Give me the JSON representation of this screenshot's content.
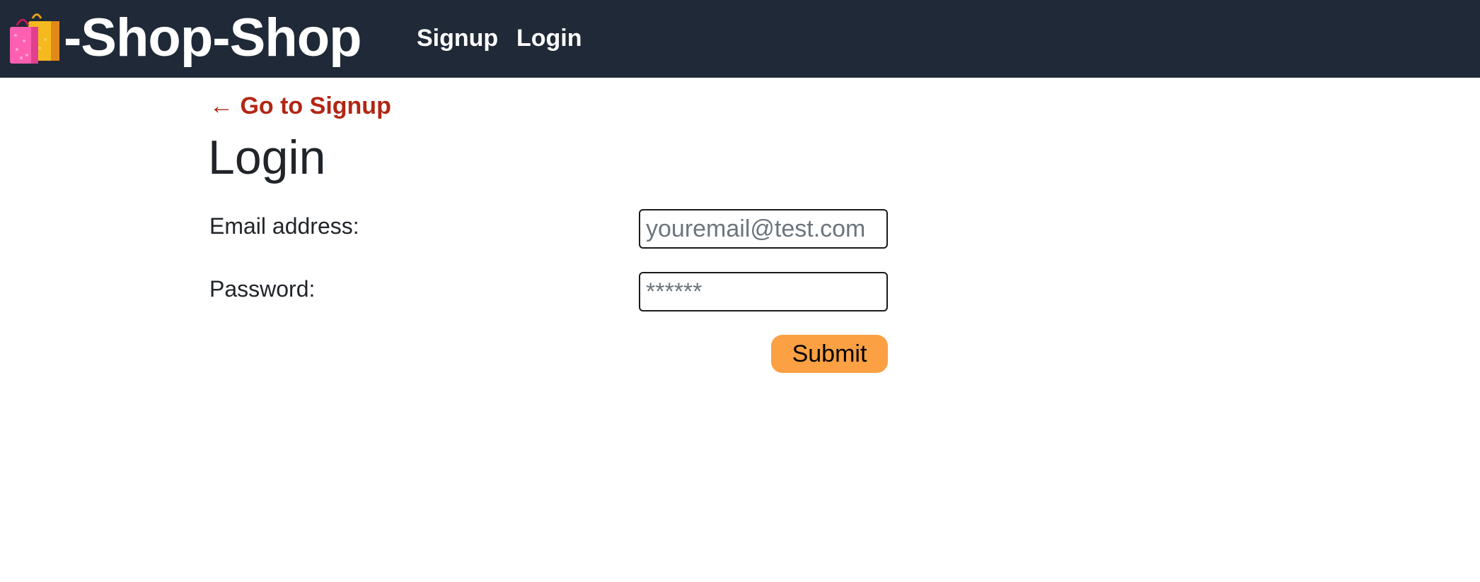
{
  "nav": {
    "brand_text": "-Shop-Shop",
    "brand_icon": "shopping-bags-icon",
    "links": [
      {
        "label": "Signup"
      },
      {
        "label": "Login"
      }
    ]
  },
  "page": {
    "back_link": "← Go to Signup",
    "title": "Login"
  },
  "form": {
    "email": {
      "label": "Email address:",
      "placeholder": "youremail@test.com",
      "value": ""
    },
    "password": {
      "label": "Password:",
      "placeholder": "******",
      "value": ""
    },
    "submit_label": "Submit"
  },
  "colors": {
    "navbar_bg": "#1f2937",
    "link_red": "#b22613",
    "button_orange": "#fba043",
    "text": "#212529"
  }
}
